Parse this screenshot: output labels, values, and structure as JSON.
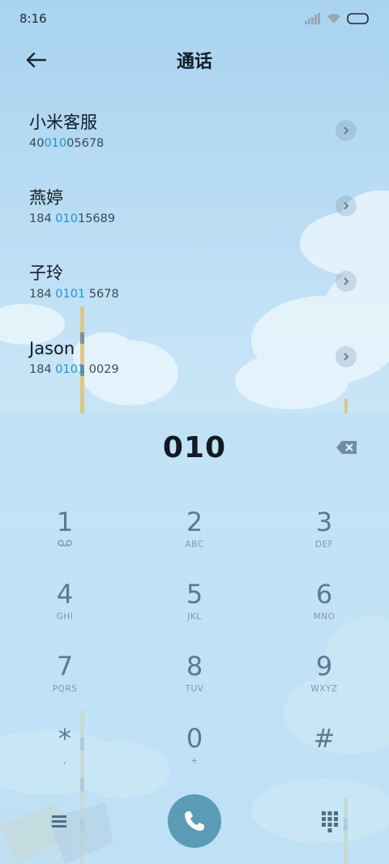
{
  "status": {
    "time": "8:16"
  },
  "header": {
    "title": "通话"
  },
  "contacts": [
    {
      "name": "小米客服",
      "number_pre": "40",
      "number_hl": "010",
      "number_post": "05678"
    },
    {
      "name": "燕婷",
      "number_pre": "184 ",
      "number_hl": "010",
      "number_post": "15689"
    },
    {
      "name": "子玲",
      "number_pre": "184 ",
      "number_hl": "0101",
      "number_post": " 5678"
    },
    {
      "name": "Jason",
      "number_pre": "184 ",
      "number_hl": "0101",
      "number_post": " 0029"
    }
  ],
  "dialer": {
    "input": "010",
    "keys": [
      {
        "digit": "1",
        "letters": ""
      },
      {
        "digit": "2",
        "letters": "ABC"
      },
      {
        "digit": "3",
        "letters": "DEF"
      },
      {
        "digit": "4",
        "letters": "GHI"
      },
      {
        "digit": "5",
        "letters": "JKL"
      },
      {
        "digit": "6",
        "letters": "MNO"
      },
      {
        "digit": "7",
        "letters": "PQRS"
      },
      {
        "digit": "8",
        "letters": "TUV"
      },
      {
        "digit": "9",
        "letters": "WXYZ"
      },
      {
        "digit": "*",
        "letters": ","
      },
      {
        "digit": "0",
        "letters": "+"
      },
      {
        "digit": "#",
        "letters": ""
      }
    ]
  },
  "icons": {
    "back": "arrow-left-icon",
    "voicemail": "voicemail-icon",
    "backspace": "backspace-icon",
    "menu": "menu-icon",
    "call": "phone-icon",
    "dialpad": "dialpad-icon"
  },
  "colors": {
    "highlight": "#1f93da",
    "call_button": "#5b9bb5",
    "key_digit": "#5a7a92"
  }
}
